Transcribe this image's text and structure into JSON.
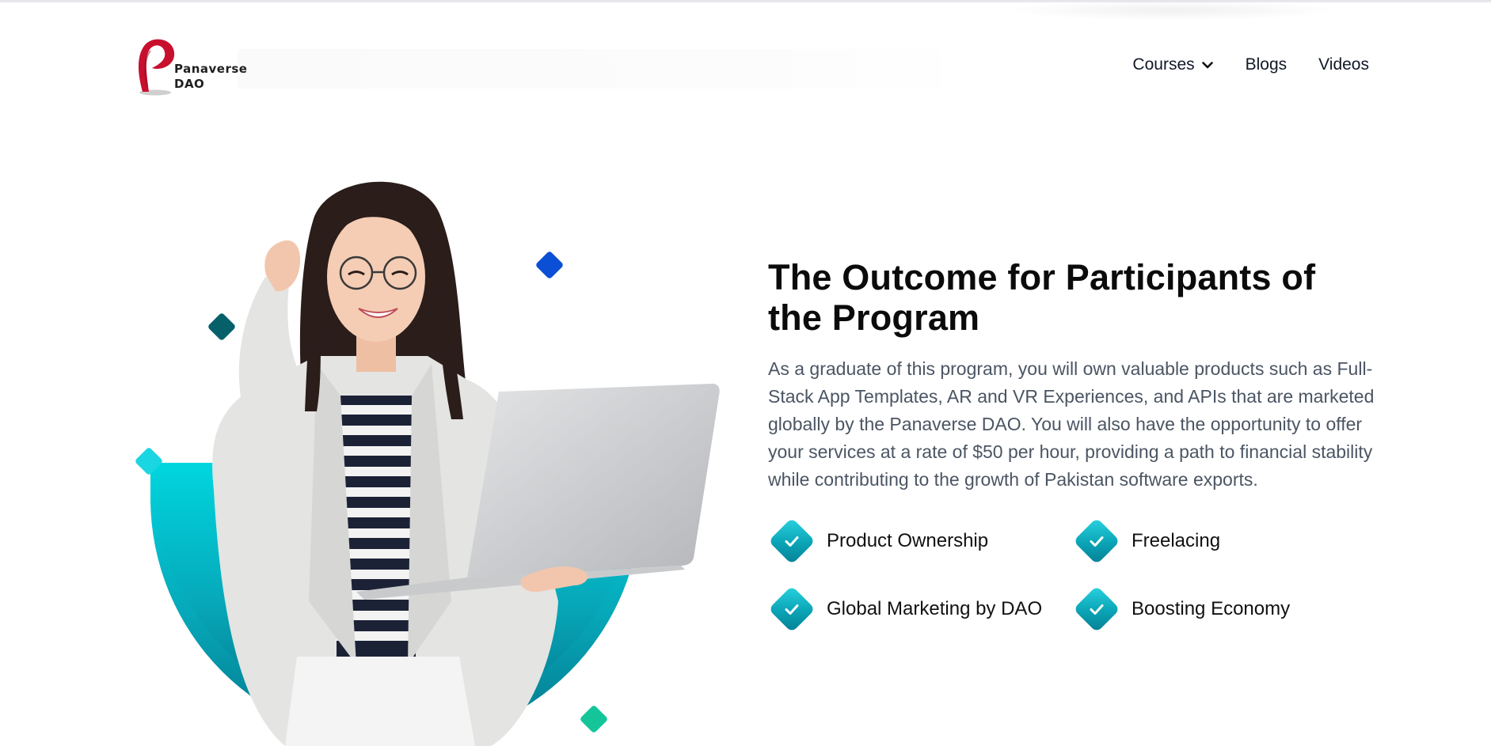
{
  "header": {
    "logo": {
      "line1": "Panaverse",
      "line2": "DAO"
    },
    "nav": [
      {
        "label": "Courses",
        "icon": "chevron-down-icon"
      },
      {
        "label": "Blogs"
      },
      {
        "label": "Videos"
      }
    ]
  },
  "hero": {
    "image": "woman-with-laptop-illustration",
    "colors": {
      "teal_dark": "#067f93",
      "teal_light": "#00d0dc",
      "blue": "#0b4fd6",
      "green": "#14c59a"
    }
  },
  "content": {
    "title": "The Outcome for Participants of the Program",
    "description": "As a graduate of this program, you will own valuable products such as Full-Stack App Templates, AR and VR Experiences, and APIs that are marketed globally by the Panaverse DAO. You will also have the opportunity to offer your services at a rate of $50 per hour, providing a path to financial stability while contributing to the growth of Pakistan software exports.",
    "features": [
      {
        "label": "Product Ownership",
        "icon": "check-icon"
      },
      {
        "label": "Freelacing",
        "icon": "check-icon"
      },
      {
        "label": "Global Marketing by DAO",
        "icon": "check-icon"
      },
      {
        "label": "Boosting Economy",
        "icon": "check-icon"
      }
    ]
  }
}
